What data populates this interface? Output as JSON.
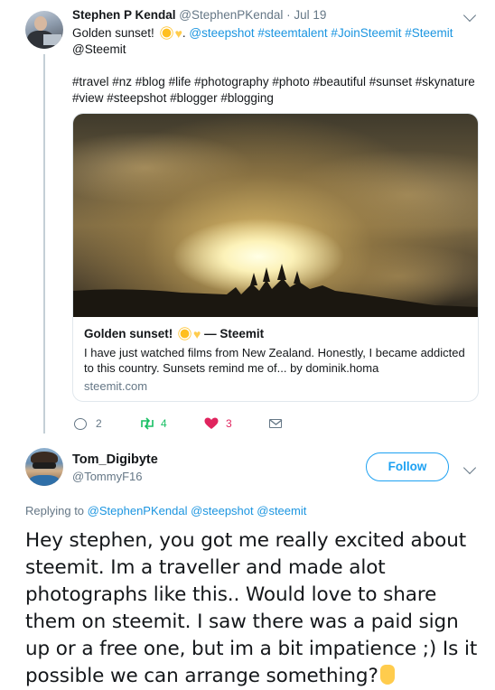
{
  "tweet1": {
    "name": "Stephen P Kendal",
    "handle": "@StephenPKendal",
    "separator": "·",
    "date": "Jul 19",
    "text_start": "Golden sunset! ",
    "text_after_emoji": ". ",
    "mentions": "@steepshot #steemtalent #JoinSteemit #Steemit",
    "mentions_line2": "@Steemit",
    "hashtags_line1": "#travel #nz #blog #life #photography #photo #beautiful #sunset #skynature",
    "hashtags_line2": "#view #steepshot #blogger #blogging",
    "card": {
      "title": "Golden sunset!",
      "title_suffix": "— Steemit",
      "description": "I have just watched films from New Zealand. Honestly, I became addicted to this country. Sunsets remind me of... by dominik.homa",
      "domain": "steemit.com"
    },
    "actions": {
      "replies": "2",
      "retweets": "4",
      "likes": "3"
    },
    "colors": {
      "link": "#1b95e0",
      "retweet": "#17bf63",
      "like": "#e0245e"
    }
  },
  "tweet2": {
    "name": "Tom_Digibyte",
    "handle": "@TommyF16",
    "follow_label": "Follow",
    "replying_to_label": "Replying to",
    "replying_to_handles": "@StephenPKendal @steepshot @steemit",
    "text": "Hey stephen, you got me really excited about steemit. Im a traveller and made alot photographs like this.. Would love to share them on steemit. I saw there was a paid sign up or a free one, but im a bit impatience ;) Is it possible we can arrange something?"
  },
  "icons": [
    "avatar",
    "chevron-down-icon",
    "sun-emoji-icon",
    "yellow-heart-emoji-icon",
    "reply-icon",
    "retweet-icon",
    "like-icon",
    "direct-message-icon",
    "crossed-fingers-emoji-icon"
  ]
}
